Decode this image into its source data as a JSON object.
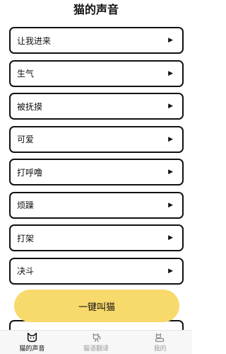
{
  "header": {
    "title": "猫的声音"
  },
  "sounds": [
    {
      "label": "让我进来"
    },
    {
      "label": "生气"
    },
    {
      "label": "被抚摸"
    },
    {
      "label": "可爱"
    },
    {
      "label": "打呼噜"
    },
    {
      "label": "烦躁"
    },
    {
      "label": "打架"
    },
    {
      "label": "决斗"
    }
  ],
  "arrow_glyph": "▶",
  "cta": {
    "label": "一键叫猫",
    "color": "#f8d96b"
  },
  "tabs": [
    {
      "label": "猫的声音",
      "icon": "cat-face-icon",
      "active": true
    },
    {
      "label": "猫语翻译",
      "icon": "cat-translate-icon",
      "active": false
    },
    {
      "label": "我的",
      "icon": "profile-icon",
      "active": false
    }
  ]
}
